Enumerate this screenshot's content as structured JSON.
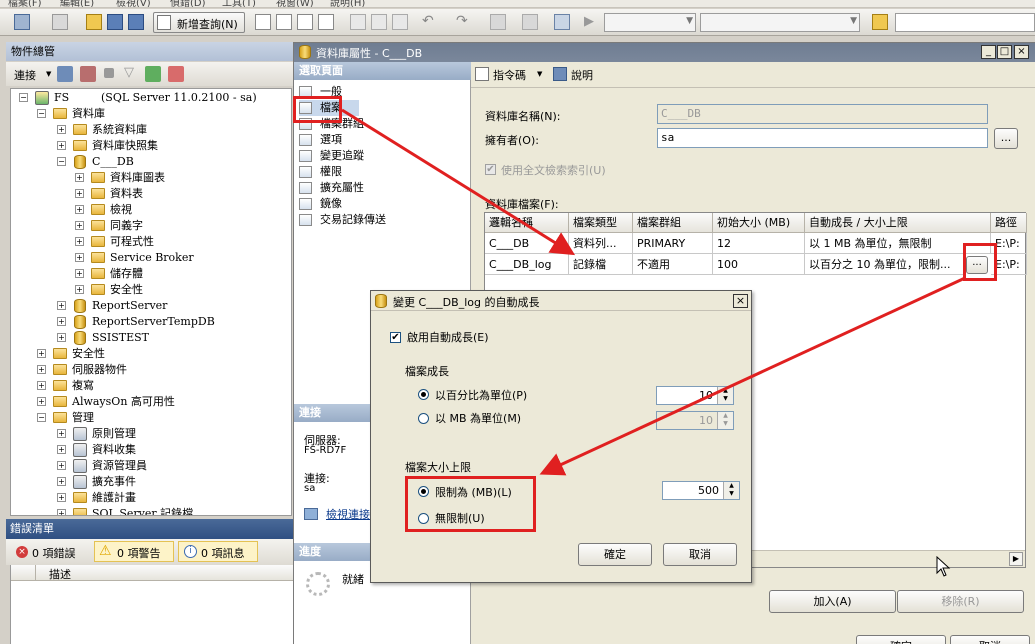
{
  "menubar": {
    "items": [
      "檔案(F)",
      "編輯(E)",
      "檢視(V)",
      "偵錯(D)",
      "工具(T)",
      "視窗(W)",
      "說明(H)"
    ]
  },
  "toolbar": {
    "new_query_label": "新增查詢(N)"
  },
  "object_explorer": {
    "title": "物件總管",
    "connect_label": "連接",
    "server": {
      "name": "FS",
      "version": "(SQL Server 11.0.2100 - sa)"
    },
    "nodes": [
      "資料庫",
      "系統資料庫",
      "資料庫快照集",
      "C___DB",
      "資料庫圖表",
      "資料表",
      "檢視",
      "同義字",
      "可程式性",
      "Service Broker",
      "儲存體",
      "安全性",
      "ReportServer",
      "ReportServerTempDB",
      "SSISTEST",
      "安全性",
      "伺服器物件",
      "複寫",
      "AlwaysOn 高可用性",
      "管理",
      "原則管理",
      "資料收集",
      "資源管理員",
      "擴充事件",
      "維護計畫",
      "SQL Server 記錄檔"
    ]
  },
  "error_list": {
    "title": "錯誤清單",
    "errors_label": "0 項錯誤",
    "warnings_label": "0 項警告",
    "messages_label": "0 項訊息",
    "column_description": "描述"
  },
  "db_properties": {
    "title": "資料庫屬性 - C___DB",
    "select_page_header": "選取頁面",
    "pages": [
      "一般",
      "檔案",
      "檔案群組",
      "選項",
      "變更追蹤",
      "權限",
      "擴充屬性",
      "鏡像",
      "交易記錄傳送"
    ],
    "script_label": "指令碼",
    "help_label": "說明",
    "db_name_label": "資料庫名稱(N):",
    "db_name_value": "C___DB",
    "owner_label": "擁有者(O):",
    "owner_value": "sa",
    "owner_browse": "...",
    "fulltext_label": "使用全文檢索索引(U)",
    "db_files_label": "資料庫檔案(F):",
    "columns": [
      "邏輯名稱",
      "檔案類型",
      "檔案群組",
      "初始大小 (MB)",
      "自動成長 / 大小上限",
      "路徑"
    ],
    "rows": [
      [
        "C___DB",
        "資料列...",
        "PRIMARY",
        "12",
        "以 1 MB 為單位，無限制",
        "E:\\P:"
      ],
      [
        "C___DB_log",
        "記錄檔",
        "不適用",
        "100",
        "以百分之 10 為單位，限制...",
        "E:\\P:"
      ]
    ],
    "ellipsis": "...",
    "connection_header": "連接",
    "server_label": "伺服器:",
    "server_value": "FS-RD7F",
    "connection_label": "連接:",
    "connection_value": "sa",
    "view_connection_link": "檢視連接",
    "progress_header": "進度",
    "progress_status": "就緒",
    "add_button": "加入(A)",
    "remove_button": "移除(R)",
    "ok_button": "確定",
    "cancel_button": "取消"
  },
  "autogrowth": {
    "title": "變更 C___DB_log 的自動成長",
    "enable_label": "啟用自動成長(E)",
    "file_growth_label": "檔案成長",
    "percent_label": "以百分比為單位(P)",
    "percent_value": "10",
    "mb_label": "以 MB 為單位(M)",
    "mb_value": "10",
    "max_size_label": "檔案大小上限",
    "limited_label": "限制為 (MB)(L)",
    "limited_value": "500",
    "unlimited_label": "無限制(U)",
    "ok_button": "確定",
    "cancel_button": "取消"
  },
  "colors": {
    "highlight": "#e02020",
    "title_bar": "#6f7d92",
    "panel_header": "#98acc6"
  }
}
